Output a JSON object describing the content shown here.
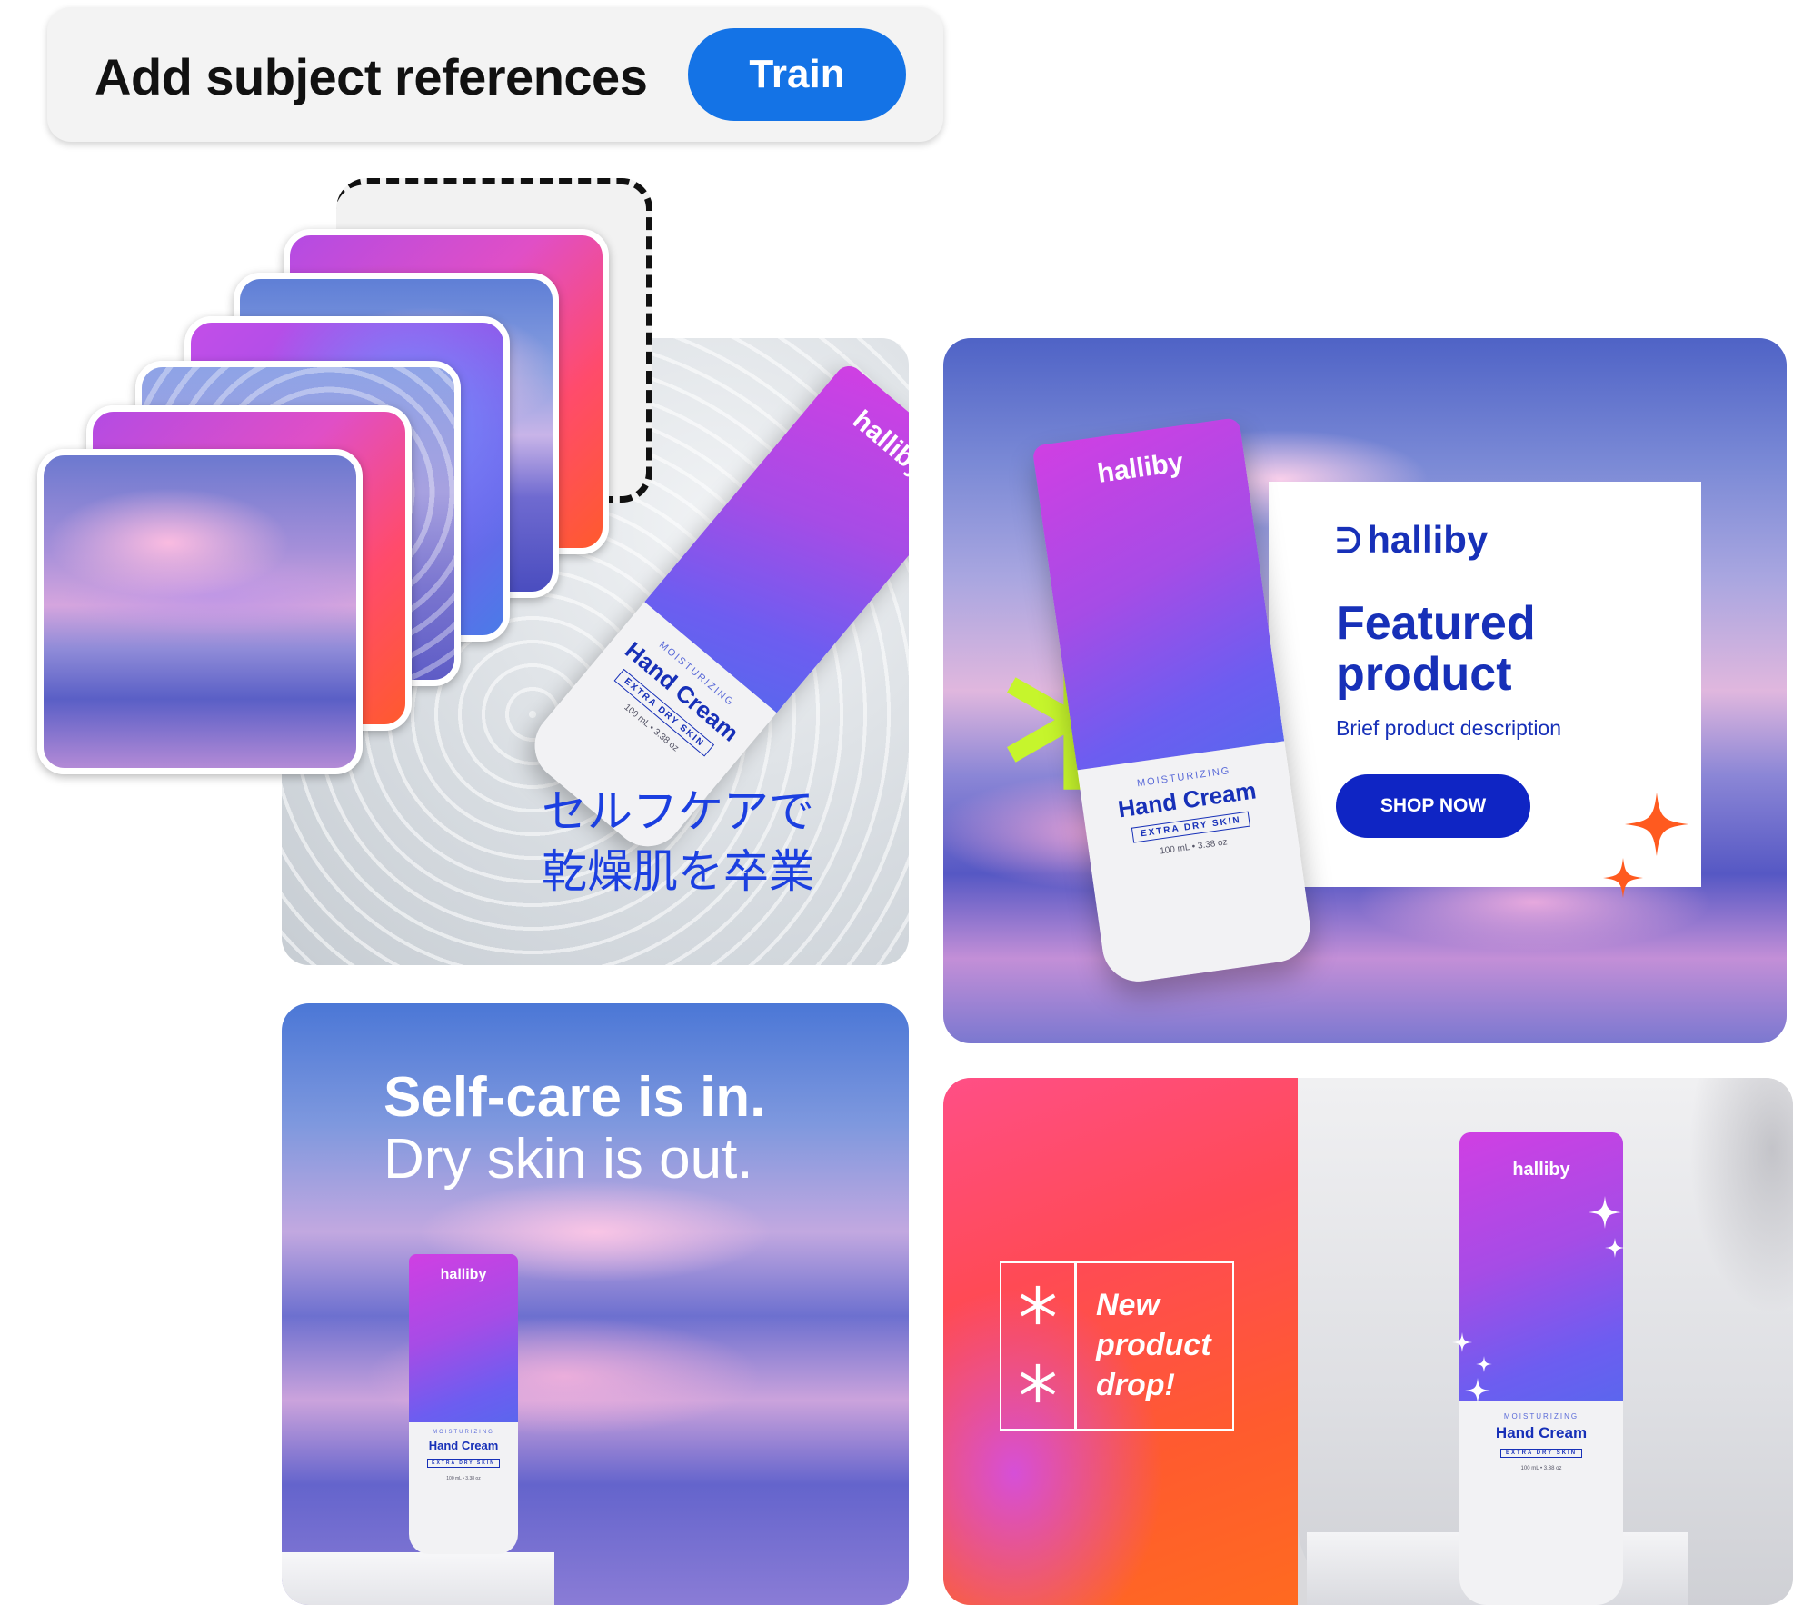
{
  "header": {
    "title": "Add subject references",
    "train_label": "Train"
  },
  "colors": {
    "accent_blue": "#1473e6",
    "brand_blue": "#1730b8",
    "lime": "#c6f52c",
    "orange": "#ff5a1f"
  },
  "reference_stack": {
    "count": 6,
    "placeholder": "dashed-empty-slot"
  },
  "tiles": {
    "water": {
      "product_brand": "halliby",
      "product_moist": "MOISTURIZING",
      "product_name": "Hand Cream",
      "product_skin": "EXTRA DRY SKIN",
      "product_size": "100 mL • 3.38 oz",
      "jp_line1": "セルフケアで",
      "jp_line2": "乾燥肌を卒業"
    },
    "featured": {
      "brand": "halliby",
      "title": "Featured product",
      "description": "Brief product description",
      "cta_label": "SHOP NOW",
      "tube_brand": "halliby",
      "tube_moist": "MOISTURIZING",
      "tube_name": "Hand Cream",
      "tube_skin": "EXTRA DRY SKIN",
      "tube_size": "100 mL • 3.38 oz"
    },
    "selfcare": {
      "line1": "Self-care is in.",
      "line2": "Dry skin is out.",
      "tube_brand": "halliby",
      "tube_moist": "MOISTURIZING",
      "tube_name": "Hand Cream",
      "tube_skin": "EXTRA DRY SKIN",
      "tube_size": "100 mL • 3.38 oz"
    },
    "drop": {
      "line1": "New",
      "line2": "product",
      "line3": "drop!",
      "tube_brand": "halliby",
      "tube_moist": "MOISTURIZING",
      "tube_name": "Hand Cream",
      "tube_skin": "EXTRA DRY SKIN",
      "tube_size": "100 mL • 3.38 oz"
    }
  }
}
